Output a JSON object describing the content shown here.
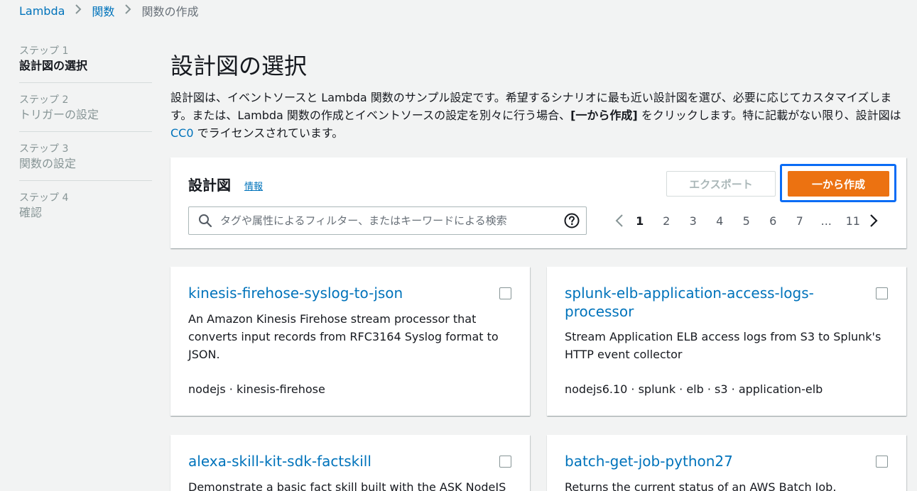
{
  "breadcrumb": {
    "items": [
      "Lambda",
      "関数"
    ],
    "current": "関数の作成"
  },
  "steps": [
    {
      "num": "ステップ 1",
      "label": "設計図の選択",
      "active": true
    },
    {
      "num": "ステップ 2",
      "label": "トリガーの設定",
      "active": false
    },
    {
      "num": "ステップ 3",
      "label": "関数の設定",
      "active": false
    },
    {
      "num": "ステップ 4",
      "label": "確認",
      "active": false
    }
  ],
  "page": {
    "title": "設計図の選択",
    "desc_part1": "設計図は、イベントソースと Lambda 関数のサンプル設定です。希望するシナリオに最も近い設計図を選び、必要に応じてカスタマイズします。または、Lambda 関数の作成とイベントソースの設定を別々に行う場合、",
    "desc_bold": "[一から作成]",
    "desc_part2": " をクリックします。特に記載がない限り、設計図は ",
    "desc_link": "CC0",
    "desc_part3": " でライセンスされています。"
  },
  "panel": {
    "title": "設計図",
    "info": "情報",
    "export_label": "エクスポート",
    "create_label": "一から作成",
    "search_placeholder": "タグや属性によるフィルター、またはキーワードによる検索"
  },
  "pagination": {
    "pages": [
      "1",
      "2",
      "3",
      "4",
      "5",
      "6",
      "7",
      "...",
      "11"
    ],
    "current": "1"
  },
  "cards": [
    {
      "title": "kinesis-firehose-syslog-to-json",
      "description": "An Amazon Kinesis Firehose stream processor that converts input records from RFC3164 Syslog format to JSON.",
      "tags": "nodejs · kinesis-firehose"
    },
    {
      "title": "splunk-elb-application-access-logs-processor",
      "description": "Stream Application ELB access logs from S3 to Splunk's HTTP event collector",
      "tags": "nodejs6.10 · splunk · elb · s3 · application-elb"
    },
    {
      "title": "alexa-skill-kit-sdk-factskill",
      "description": "Demonstrate a basic fact skill built with the ASK NodeJS",
      "tags": ""
    },
    {
      "title": "batch-get-job-python27",
      "description": "Returns the current status of an AWS Batch Job.",
      "tags": ""
    }
  ],
  "colors": {
    "link": "#0073bb",
    "primary_button": "#ec7211",
    "focus_ring": "#0a6cf5",
    "background": "#f2f3f3"
  }
}
